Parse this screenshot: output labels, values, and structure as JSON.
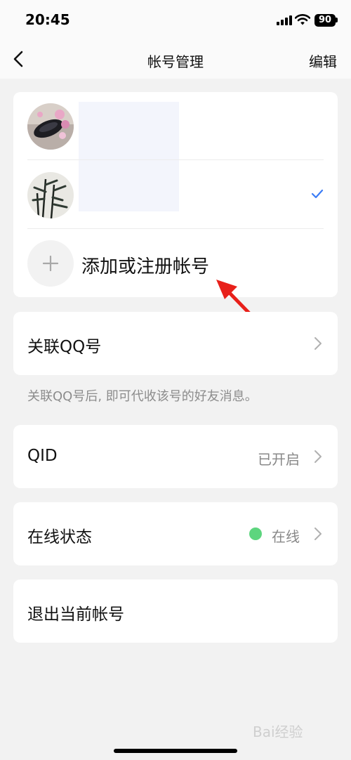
{
  "status_bar": {
    "time": "20:45",
    "battery": "90"
  },
  "nav": {
    "title": "帐号管理",
    "edit_label": "编辑"
  },
  "accounts": {
    "items": [
      {
        "selected": false
      },
      {
        "selected": true
      }
    ],
    "add_label": "添加或注册帐号"
  },
  "link_qq": {
    "label": "关联QQ号",
    "note": "关联QQ号后, 即可代收该号的好友消息。"
  },
  "qid": {
    "label": "QID",
    "value": "已开启"
  },
  "online_status": {
    "label": "在线状态",
    "value": "在线",
    "dot_color": "#5dd57e"
  },
  "logout": {
    "label": "退出当前帐号"
  },
  "watermark": "Bai经验",
  "colors": {
    "accent_check": "#3b7cf6",
    "annotation_arrow": "#e8201a"
  }
}
